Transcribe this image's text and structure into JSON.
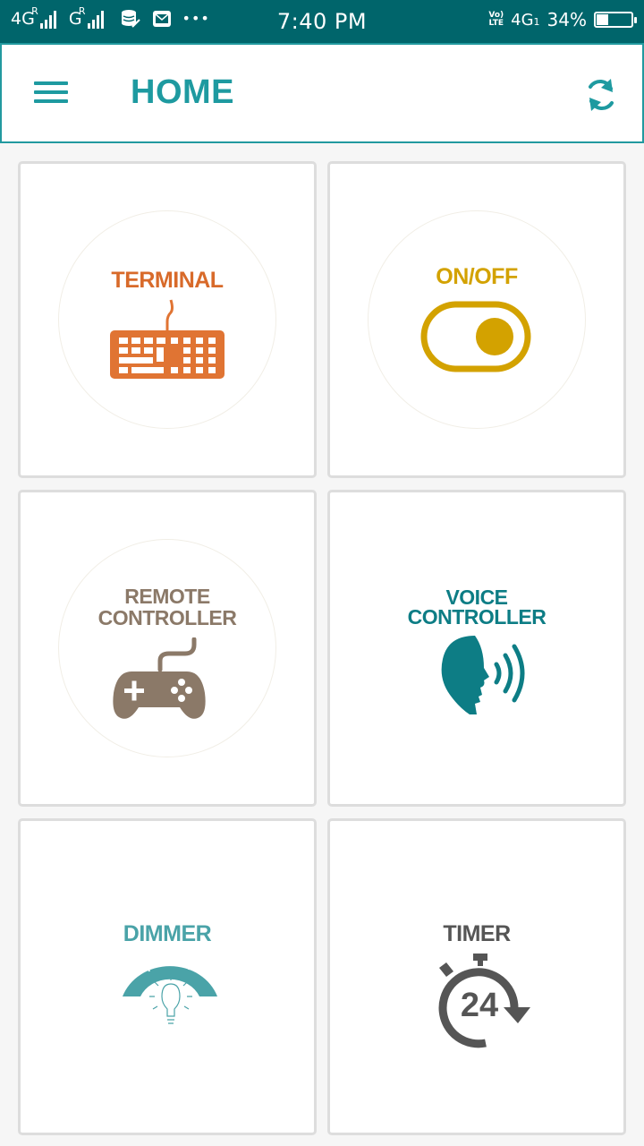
{
  "status_bar": {
    "sim1_network": "4G",
    "sim1_roaming": "R",
    "sim2_network": "G",
    "sim2_roaming": "R",
    "more_indicator": "•••",
    "time": "7:40 PM",
    "volte_line1": "Vo)",
    "volte_line2": "LTE",
    "data_network": "4G",
    "data_sim": "1",
    "battery_percent": "34%",
    "battery_level": 0.34
  },
  "app_bar": {
    "title": "HOME",
    "accent_color": "#1e9aa0",
    "menu_icon": "hamburger-menu-icon",
    "refresh_icon": "refresh-icon"
  },
  "tiles": [
    {
      "label": "TERMINAL",
      "color": "#e07433",
      "icon": "keyboard-icon"
    },
    {
      "label": "ON/OFF",
      "color": "#d3a200",
      "icon": "toggle-switch-icon"
    },
    {
      "label": "REMOTE\nCONTROLLER",
      "color": "#8b7968",
      "icon": "gamepad-icon"
    },
    {
      "label": "VOICE\nCONTROLLER",
      "color": "#0d7d85",
      "icon": "speaking-head-icon"
    },
    {
      "label": "DIMMER",
      "color": "#4aa3a8",
      "icon": "lightbulb-dial-icon"
    },
    {
      "label": "TIMER",
      "color": "#555555",
      "icon": "stopwatch-24-icon"
    }
  ],
  "timer_badge": "24"
}
